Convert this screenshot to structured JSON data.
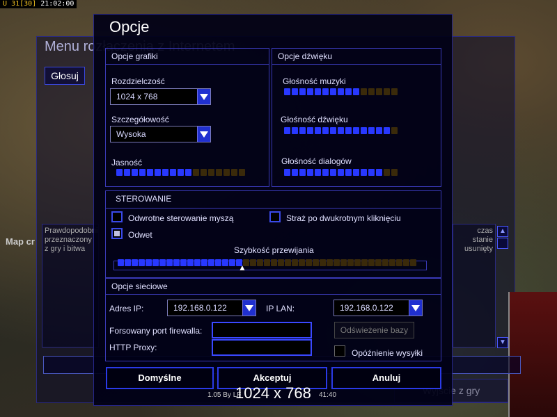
{
  "status": {
    "letter": "U",
    "num1": "31",
    "num2": "[30]",
    "clock": "21:02:00"
  },
  "background": {
    "menu_title": "Menu rozłączenia z Internetem",
    "vote_button": "Głosuj",
    "map_label": "Map cr",
    "desc_left": "Prawdopodobnie przeznaczony z gry i bitwa",
    "desc_right": "czas stanie usunięty",
    "scroll_up": "▲",
    "scroll_down": "▼",
    "exit_button": "Wyjście z gry"
  },
  "dialog": {
    "title": "Opcje",
    "graphics": {
      "heading": "Opcje grafiki",
      "resolution_label": "Rozdzielczość",
      "resolution_value": "1024 x 768",
      "detail_label": "Szczegółowość",
      "detail_value": "Wysoka",
      "brightness_label": "Jasność",
      "brightness": {
        "filled": 10,
        "total": 17
      }
    },
    "sound": {
      "heading": "Opcje dźwięku",
      "music_label": "Głośność muzyki",
      "music": {
        "filled": 10,
        "total": 15
      },
      "sfx_label": "Głośność dźwięku",
      "sfx": {
        "filled": 14,
        "total": 15
      },
      "voice_label": "Głośność dialogów",
      "voice": {
        "filled": 13,
        "total": 15
      }
    },
    "controls": {
      "heading": "STEROWANIE",
      "invert_mouse_label": "Odwrotne sterowanie myszą",
      "invert_mouse_checked": false,
      "guard_label": "Straż po dwukrotnym kliknięciu",
      "guard_checked": false,
      "retaliation_label": "Odwet",
      "retaliation_checked": true,
      "scroll_speed_label": "Szybkość przewijania",
      "scroll_speed": {
        "filled": 18,
        "total": 43
      },
      "scroll_thumb": "▲"
    },
    "network": {
      "heading": "Opcje sieciowe",
      "ip_label": "Adres IP:",
      "ip_value": "192.168.0.122",
      "lan_label": "IP LAN:",
      "lan_value": "192.168.0.122",
      "firewall_label": "Forsowany port firewalla:",
      "firewall_value": "",
      "proxy_label": "HTTP Proxy:",
      "proxy_value": "",
      "refresh_button": "Odświeżenie bazy",
      "send_delay_label": "Opóźnienie wysyłki",
      "send_delay_checked": false
    },
    "buttons": {
      "defaults": "Domyślne",
      "accept": "Akceptuj",
      "cancel": "Anuluj"
    }
  },
  "footer": {
    "version": "1.05 By LF",
    "version_tail": "41:40",
    "resolution_overlay": "1024 x 768"
  },
  "colors": {
    "accent": "#2838ff",
    "slider_off": "#3a2a0a",
    "panel_border": "#3a3ab8"
  }
}
